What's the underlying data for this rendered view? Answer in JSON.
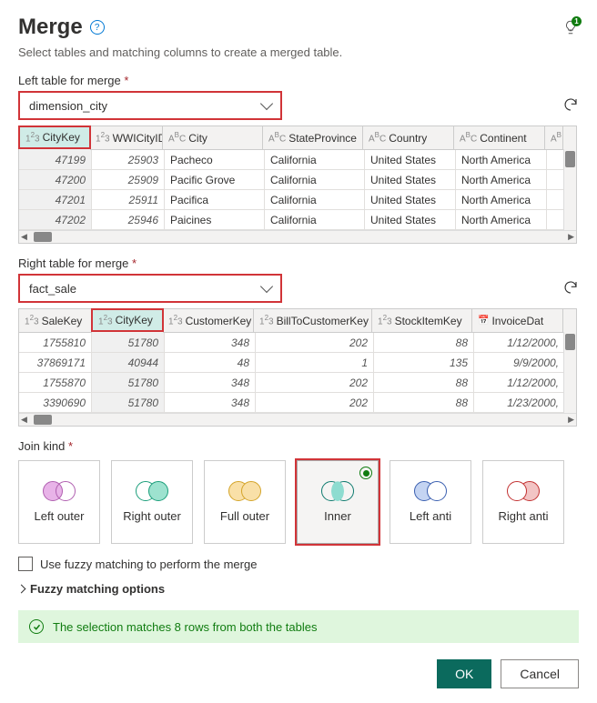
{
  "header": {
    "title": "Merge",
    "tip_badge": "1"
  },
  "subtitle": "Select tables and matching columns to create a merged table.",
  "left_section": {
    "label": "Left table for merge",
    "value": "dimension_city",
    "columns": [
      {
        "name": "CityKey",
        "type": "num"
      },
      {
        "name": "WWICityID",
        "type": "num"
      },
      {
        "name": "City",
        "type": "text"
      },
      {
        "name": "StateProvince",
        "type": "text"
      },
      {
        "name": "Country",
        "type": "text"
      },
      {
        "name": "Continent",
        "type": "text"
      },
      {
        "name": "",
        "type": "text"
      }
    ],
    "rows": [
      {
        "c0": "47199",
        "c1": "25903",
        "c2": "Pacheco",
        "c3": "California",
        "c4": "United States",
        "c5": "North America"
      },
      {
        "c0": "47200",
        "c1": "25909",
        "c2": "Pacific Grove",
        "c3": "California",
        "c4": "United States",
        "c5": "North America"
      },
      {
        "c0": "47201",
        "c1": "25911",
        "c2": "Pacifica",
        "c3": "California",
        "c4": "United States",
        "c5": "North America"
      },
      {
        "c0": "47202",
        "c1": "25946",
        "c2": "Paicines",
        "c3": "California",
        "c4": "United States",
        "c5": "North America"
      }
    ]
  },
  "right_section": {
    "label": "Right table for merge",
    "value": "fact_sale",
    "columns": [
      {
        "name": "SaleKey",
        "type": "num"
      },
      {
        "name": "CityKey",
        "type": "num"
      },
      {
        "name": "CustomerKey",
        "type": "num"
      },
      {
        "name": "BillToCustomerKey",
        "type": "num"
      },
      {
        "name": "StockItemKey",
        "type": "num"
      },
      {
        "name": "InvoiceDat",
        "type": "date"
      }
    ],
    "rows": [
      {
        "c0": "1755810",
        "c1": "51780",
        "c2": "348",
        "c3": "202",
        "c4": "88",
        "c5": "1/12/2000,"
      },
      {
        "c0": "37869171",
        "c1": "40944",
        "c2": "48",
        "c3": "1",
        "c4": "135",
        "c5": "9/9/2000,"
      },
      {
        "c0": "1755870",
        "c1": "51780",
        "c2": "348",
        "c3": "202",
        "c4": "88",
        "c5": "1/12/2000,"
      },
      {
        "c0": "3390690",
        "c1": "51780",
        "c2": "348",
        "c3": "202",
        "c4": "88",
        "c5": "1/23/2000,"
      }
    ]
  },
  "join": {
    "label": "Join kind",
    "options": {
      "left_outer": "Left outer",
      "right_outer": "Right outer",
      "full_outer": "Full outer",
      "inner": "Inner",
      "left_anti": "Left anti",
      "right_anti": "Right anti"
    }
  },
  "fuzzy_check": "Use fuzzy matching to perform the merge",
  "fuzzy_expand": "Fuzzy matching options",
  "status": "The selection matches 8 rows from both the tables",
  "buttons": {
    "ok": "OK",
    "cancel": "Cancel"
  }
}
